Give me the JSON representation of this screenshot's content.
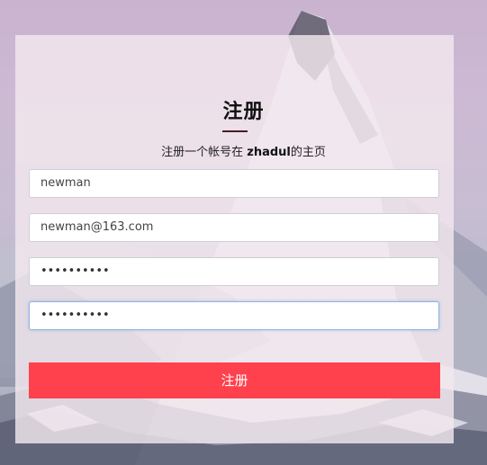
{
  "form": {
    "title": "注册",
    "subtitle_prefix": "注册一个帐号在 ",
    "subtitle_brand": "zhadul",
    "subtitle_suffix": "的主页",
    "username_value": "newman",
    "email_value": "newman@163.com",
    "password_value": "••••••••••",
    "confirm_password_value": "••••••••••",
    "submit_label": "注册"
  },
  "colors": {
    "submit_bg": "#ff414d",
    "title_underline": "#4b1c23",
    "focus_border": "#8fb5e6"
  }
}
